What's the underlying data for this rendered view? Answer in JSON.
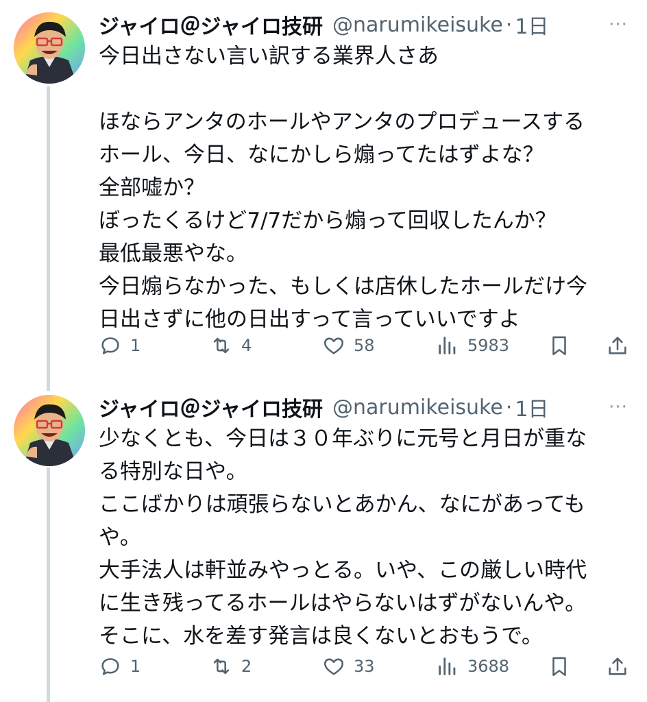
{
  "tweets": [
    {
      "name": "ジャイロ＠ジャイロ技研",
      "handle": "@narumikeisuke",
      "separator": "·",
      "time": "1日",
      "more": "···",
      "text": "今日出さない言い訳する業界人さあ\n\nほならアンタのホールやアンタのプロデュースする\nホール、今日、なにかしら煽ってたはずよな？\n全部嘘か？\nぼったくるけど7/7だから煽って回収したんか？\n最低最悪やな。\n今日煽らなかった、もしくは店休したホールだけ今\n日出さずに他の日出すって言っていいですよ",
      "replies": "1",
      "reposts": "4",
      "likes": "58",
      "views": "5983",
      "icons": {
        "reply": "reply-icon",
        "repost": "repost-icon",
        "like": "like-icon",
        "views": "views-icon",
        "bookmark": "bookmark-icon",
        "share": "share-icon"
      }
    },
    {
      "name": "ジャイロ＠ジャイロ技研",
      "handle": "@narumikeisuke",
      "separator": "·",
      "time": "1日",
      "more": "···",
      "text": "少なくとも、今日は３０年ぶりに元号と月日が重な\nる特別な日や。\nここばかりは頑張らないとあかん、なにがあっても\nや。\n大手法人は軒並みやっとる。いや、この厳しい時代\nに生き残ってるホールはやらないはずがないんや。\nそこに、水を差す発言は良くないとおもうで。",
      "replies": "1",
      "reposts": "2",
      "likes": "33",
      "views": "3688",
      "icons": {
        "reply": "reply-icon",
        "repost": "repost-icon",
        "like": "like-icon",
        "views": "views-icon",
        "bookmark": "bookmark-icon",
        "share": "share-icon"
      }
    }
  ],
  "colors": {
    "text": "#0f1419",
    "muted": "#536471",
    "thread": "#cfd9de"
  }
}
